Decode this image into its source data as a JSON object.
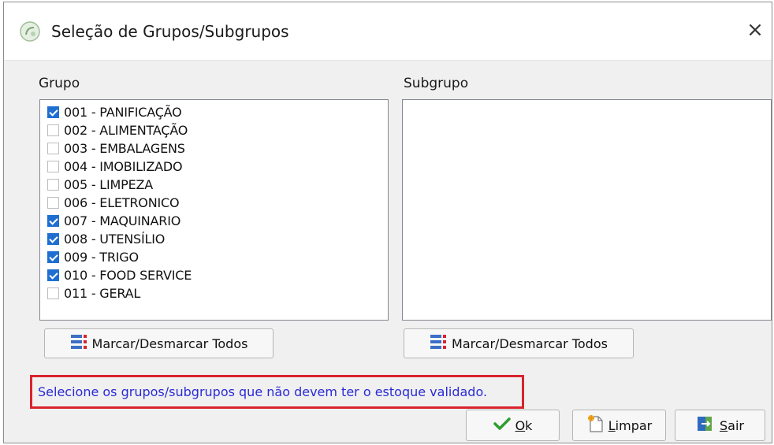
{
  "window": {
    "title": "Seleção de Grupos/Subgrupos",
    "close_label": "×"
  },
  "groups": {
    "label": "Grupo",
    "items": [
      {
        "label": "001 - PANIFICAÇÃO",
        "checked": true
      },
      {
        "label": "002 - ALIMENTAÇÃO",
        "checked": false
      },
      {
        "label": "003 - EMBALAGENS",
        "checked": false
      },
      {
        "label": "004 - IMOBILIZADO",
        "checked": false
      },
      {
        "label": "005 - LIMPEZA",
        "checked": false
      },
      {
        "label": "006 - ELETRONICO",
        "checked": false
      },
      {
        "label": "007 - MAQUINARIO",
        "checked": true
      },
      {
        "label": "008 - UTENSÍLIO",
        "checked": true
      },
      {
        "label": "009 - TRIGO",
        "checked": true
      },
      {
        "label": "010 - FOOD SERVICE",
        "checked": true
      },
      {
        "label": "011 - GERAL",
        "checked": false
      }
    ],
    "toggle_all_label": "Marcar/Desmarcar Todos"
  },
  "subgroups": {
    "label": "Subgrupo",
    "items": [],
    "toggle_all_label": "Marcar/Desmarcar Todos"
  },
  "notice": "Selecione os grupos/subgrupos que não devem ter o estoque validado.",
  "buttons": {
    "ok": {
      "underline": "O",
      "rest": "k"
    },
    "clear": {
      "underline": "L",
      "rest": "impar"
    },
    "exit": {
      "underline": "S",
      "rest": "air"
    }
  },
  "icons": {
    "app": "app-logo-icon",
    "toggle_all": "checklist-icon",
    "ok": "checkmark-icon",
    "clear": "clear-document-icon",
    "exit": "exit-door-icon"
  },
  "colors": {
    "checkbox_checked": "#1f6fd1",
    "notice_text": "#2a2ad6",
    "notice_border": "#d9232d",
    "ok_check": "#2e9e2e"
  }
}
